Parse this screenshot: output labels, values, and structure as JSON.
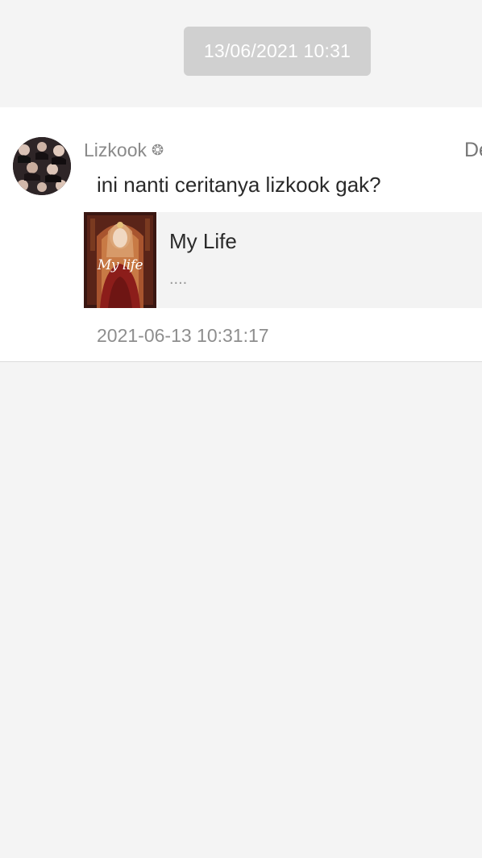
{
  "thread": {
    "timestamp_header": "13/06/2021 10:31"
  },
  "comment": {
    "username": "Lizkook",
    "username_flag": "❂",
    "right_action_label": "De",
    "text": "ini nanti ceritanya lizkook gak?",
    "date": "2021-06-13 10:31:17"
  },
  "story": {
    "title": "My Life",
    "description": "....",
    "cover_text": "My life"
  }
}
